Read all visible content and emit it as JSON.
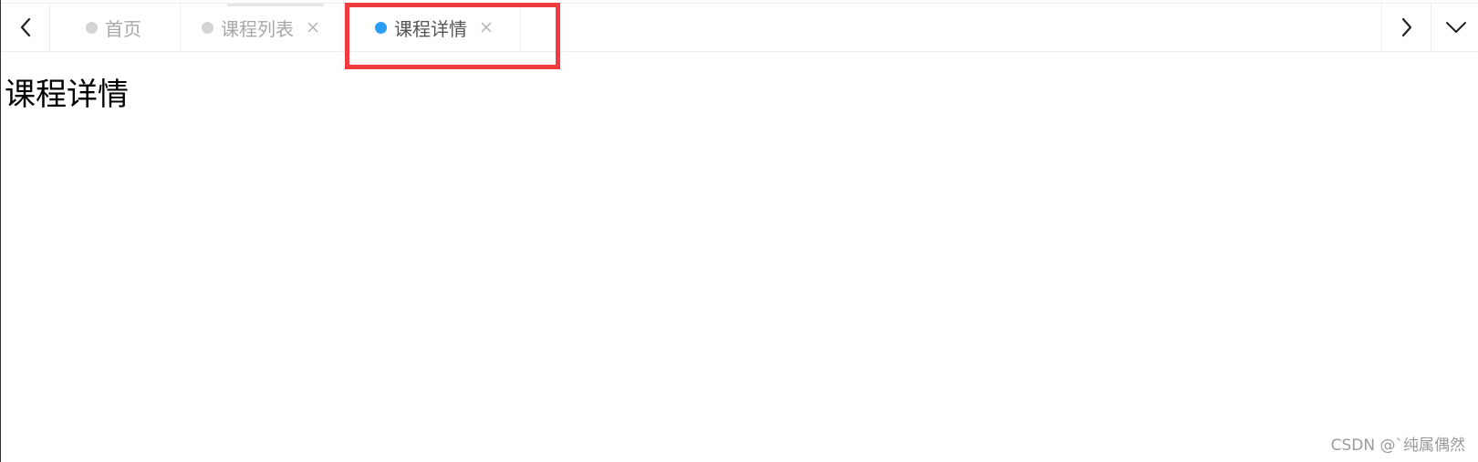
{
  "tabs_bar": {
    "prev_icon": "chevron-left-icon",
    "next_icon": "chevron-right-icon",
    "more_icon": "chevron-down-icon",
    "tabs": [
      {
        "label": "首页",
        "active": false,
        "closable": false
      },
      {
        "label": "课程列表",
        "active": false,
        "closable": true
      },
      {
        "label": "课程详情",
        "active": true,
        "closable": true
      }
    ],
    "active_dot_color": "#2a9df4",
    "inactive_dot_color": "#d4d4d4",
    "highlight_color": "#f23b3f"
  },
  "content": {
    "title": "课程详情"
  },
  "watermark": "CSDN @`纯属偶然"
}
